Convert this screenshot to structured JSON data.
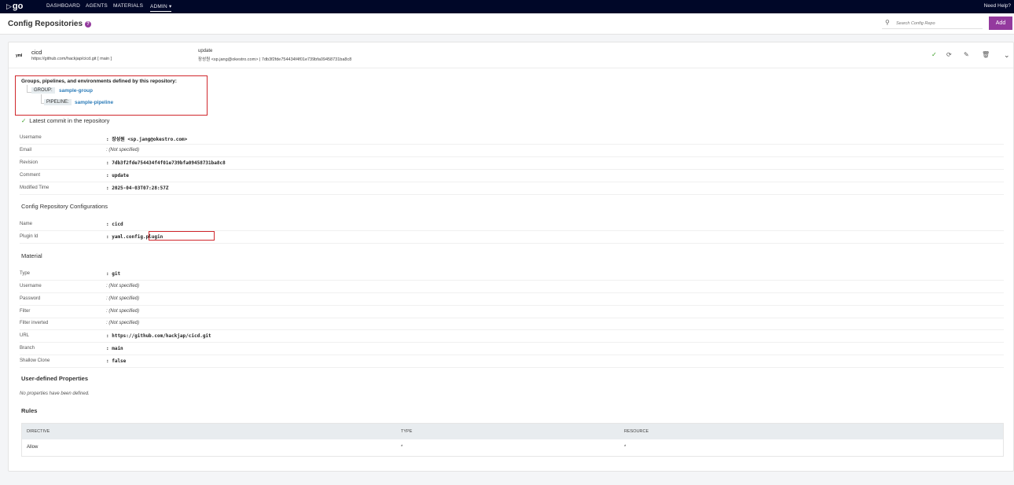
{
  "nav": {
    "logo": "go",
    "items": [
      "DASHBOARD",
      "AGENTS",
      "MATERIALS",
      "ADMIN ▾"
    ],
    "help": "Need Help?"
  },
  "header": {
    "title": "Config Repositories",
    "search_placeholder": "Search Config Repo",
    "add_label": "Add"
  },
  "repo": {
    "icon_text": "yml",
    "name": "cicd",
    "url": "https://github.com/hackjap/cicd.git [ main ]",
    "commit_message": "update",
    "commit_info": "장성원 <sp.jang@okestro.com> | 7db3f2fde754434f4f01e739bfa09458731ba8c8"
  },
  "defined": {
    "title": "Groups, pipelines, and environments defined by this repository:",
    "group_label": "GROUP:",
    "group_name": "sample-group",
    "pipeline_label": "PIPELINE:",
    "pipeline_name": "sample-pipeline"
  },
  "latest_commit": {
    "heading": "Latest commit in the repository",
    "rows": [
      {
        "label": "Username",
        "value": ": 장성원 <sp.jang@okestro.com>"
      },
      {
        "label": "Email",
        "value": ": (Not specified)"
      },
      {
        "label": "Revision",
        "value": ": 7db3f2fde754434f4f01e739bfa09458731ba8c8"
      },
      {
        "label": "Comment",
        "value": ": update"
      },
      {
        "label": "Modified Time",
        "value": ": 2025-04-03T07:28:57Z"
      }
    ]
  },
  "config": {
    "heading": "Config Repository Configurations",
    "rows": [
      {
        "label": "Name",
        "value": ": cicd"
      },
      {
        "label": "Plugin Id",
        "value": ": yaml.config.plugin"
      }
    ]
  },
  "material": {
    "heading": "Material",
    "rows": [
      {
        "label": "Type",
        "value": ": git"
      },
      {
        "label": "Username",
        "value": ": (Not specified)"
      },
      {
        "label": "Password",
        "value": ": (Not specified)"
      },
      {
        "label": "Filter",
        "value": ": (Not specified)"
      },
      {
        "label": "Filter inverted",
        "value": ": (Not specified)"
      },
      {
        "label": "URL",
        "value": ": https://github.com/hackjap/cicd.git"
      },
      {
        "label": "Branch",
        "value": ": main"
      },
      {
        "label": "Shallow Clone",
        "value": ": false"
      }
    ]
  },
  "user_props": {
    "heading": "User-defined Properties",
    "empty": "No properties have been defined."
  },
  "rules": {
    "heading": "Rules",
    "columns": [
      "DIRECTIVE",
      "TYPE",
      "RESOURCE"
    ],
    "rows": [
      [
        "Allow",
        "*",
        "*"
      ]
    ]
  }
}
